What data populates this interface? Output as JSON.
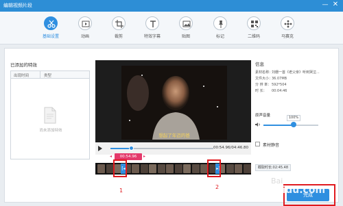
{
  "window": {
    "title": "编辑视频片段",
    "minimize_glyph": "—",
    "close_glyph": "✕"
  },
  "toolbar": {
    "items": [
      {
        "label": "基础设置",
        "icon": "scissors-icon",
        "active": true
      },
      {
        "label": "动画",
        "icon": "animation-icon",
        "active": false
      },
      {
        "label": "裁剪",
        "icon": "crop-icon",
        "active": false
      },
      {
        "label": "特效字幕",
        "icon": "text-icon",
        "active": false
      },
      {
        "label": "贴图",
        "icon": "image-icon",
        "active": false
      },
      {
        "label": "标记",
        "icon": "pin-icon",
        "active": false
      },
      {
        "label": "二维码",
        "icon": "qrcode-icon",
        "active": false
      },
      {
        "label": "马赛克",
        "icon": "mosaic-icon",
        "active": false
      }
    ]
  },
  "effects_panel": {
    "title": "已添加的特效",
    "columns": [
      "出现时间",
      "类型"
    ],
    "empty_text": "尚未添加特效"
  },
  "player": {
    "subtitle": "想起了年迈的爸",
    "timecode": "00:54.96/04:46.80",
    "progress_fraction": 0.2
  },
  "clip": {
    "time_label": "00:54.96",
    "start_marker": "[◂",
    "end_marker": "▸]",
    "annotation_1": "1",
    "annotation_2": "2"
  },
  "info_panel": {
    "title": "信息",
    "rows": [
      {
        "key": "素材名称：",
        "value": "刘珊一首《老父亲》听到哭泣..."
      },
      {
        "key": "文件大小：",
        "value": "36.07MB"
      },
      {
        "key": "分 辨 率：",
        "value": "592*504"
      },
      {
        "key": "时    长：",
        "value": "00:04:46"
      }
    ],
    "volume_title": "原声音量",
    "volume_value": "100%",
    "volume_fraction": 0.55,
    "mute_label": "素材静音",
    "duration_label": "截取时长:02:45.48"
  },
  "actions": {
    "ok_label": "完成"
  },
  "watermark": {
    "text": "aidu.com",
    "text2": "Bai"
  },
  "colors": {
    "accent": "#2f8fe0",
    "titlebar": "#2d8ed6",
    "highlight": "#e0191e",
    "clip_badge": "#e4396b"
  }
}
